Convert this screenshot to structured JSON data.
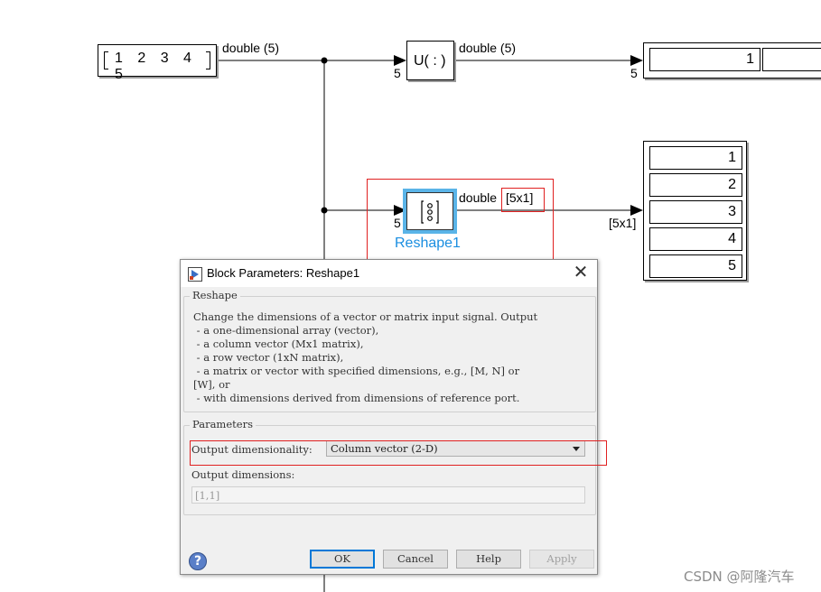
{
  "diagram": {
    "constant_block": {
      "value": "1 2 3 4 5"
    },
    "signal_labels": {
      "top_left": "double (5)",
      "top_right": "double (5)",
      "middle": "double",
      "middle_dims": "[5x1]",
      "display2_in": "[5x1]"
    },
    "port_labels": {
      "u_in": "5",
      "display1_in": "5",
      "reshape_in": "5"
    },
    "u_block": {
      "label": "U( : )"
    },
    "display1": {
      "values": [
        "1",
        ""
      ]
    },
    "display2": {
      "values": [
        "1",
        "2",
        "3",
        "4",
        "5"
      ]
    },
    "reshape_block": {
      "name": "Reshape1"
    }
  },
  "dialog": {
    "title": "Block Parameters: Reshape1",
    "close_glyph": "✕",
    "block_group_title": "Reshape",
    "description_lines": [
      "Change the dimensions of a vector or matrix input signal. Output",
      " - a one-dimensional array (vector),",
      " - a column vector (Mx1 matrix),",
      " - a row vector (1xN matrix),",
      " - a matrix or vector with specified dimensions, e.g., [M, N] or",
      "[W], or",
      " - with dimensions derived from dimensions of reference port."
    ],
    "parameters_group_title": "Parameters",
    "output_dimensionality_label": "Output dimensionality:",
    "output_dimensionality_value": "Column vector (2-D)",
    "output_dimensions_label": "Output dimensions:",
    "output_dimensions_value": "[1,1]",
    "help_glyph": "?",
    "buttons": {
      "ok": "OK",
      "cancel": "Cancel",
      "help": "Help",
      "apply": "Apply"
    }
  },
  "watermark": "CSDN @阿隆汽车",
  "colors": {
    "selection_blue": "#5ab4e8",
    "block_name_blue": "#1a8ee0",
    "highlight_red": "#e02020",
    "ok_border": "#0078d7"
  }
}
